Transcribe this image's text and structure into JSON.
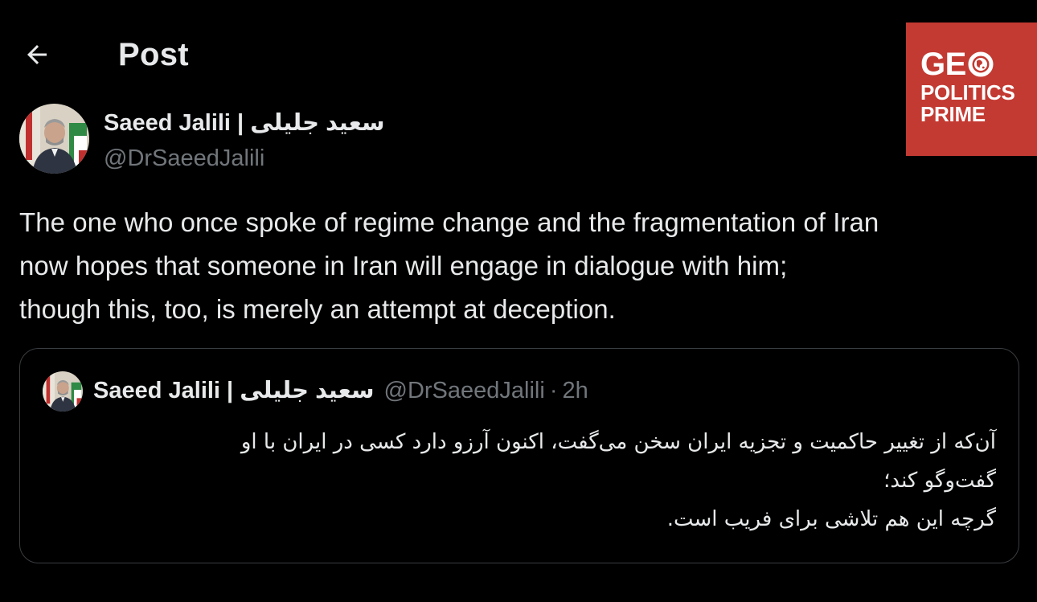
{
  "header": {
    "back_icon": "arrow-left-icon",
    "title": "Post"
  },
  "watermark": {
    "line1": "GE",
    "line2": "POLITICS",
    "line3": "PRIME",
    "background": "#c33a32",
    "globe_icon": "globe-icon"
  },
  "author": {
    "name": "Saeed Jalili | سعید جلیلی",
    "handle": "@DrSaeedJalili"
  },
  "post": {
    "lines": [
      "The one who once spoke of regime change and the fragmentation of Iran",
      "now hopes that someone in Iran will engage in dialogue with him;",
      "though this, too, is merely an attempt at deception."
    ]
  },
  "quote": {
    "name": "Saeed Jalili | سعید جلیلی",
    "handle": "@DrSaeedJalili",
    "separator": "·",
    "time": "2h",
    "lines": [
      "آن‌که از تغییر حاکمیت و تجزیه ایران سخن می‌گفت، اکنون آرزو دارد کسی در ایران با او",
      "گفت‌وگو کند؛",
      "گرچه این هم تلاشی برای فریب است."
    ]
  },
  "colors": {
    "background": "#000000",
    "text_primary": "#e7e9ea",
    "text_secondary": "#71767b",
    "border": "#3a3d41"
  }
}
